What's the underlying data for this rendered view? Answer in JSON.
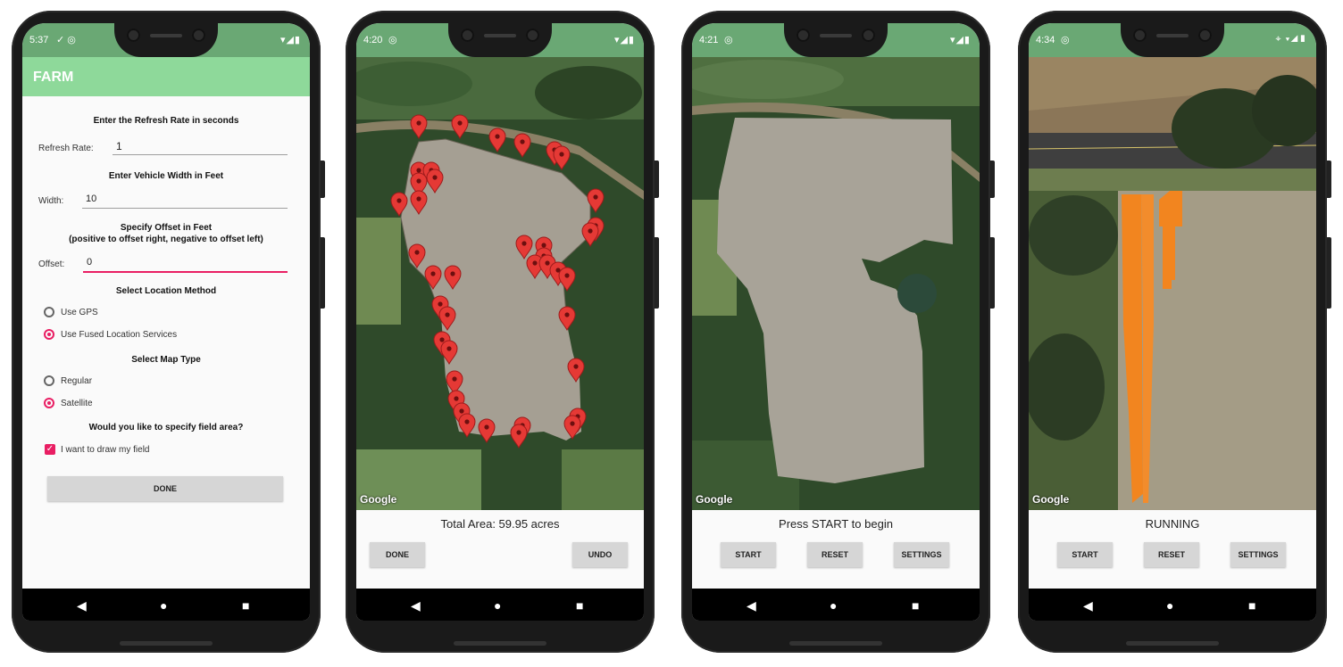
{
  "phones": [
    {
      "status": {
        "time": "5:37",
        "icons": "▾◢▮"
      },
      "app_title": "FARM",
      "form": {
        "refresh_header": "Enter the Refresh Rate in seconds",
        "refresh_label": "Refresh Rate:",
        "refresh_value": "1",
        "width_header": "Enter Vehicle Width in Feet",
        "width_label": "Width:",
        "width_value": "10",
        "offset_header_line1": "Specify Offset in Feet",
        "offset_header_line2": "(positive to offset right, negative to offset left)",
        "offset_label": "Offset:",
        "offset_value": "0",
        "location_header": "Select Location Method",
        "use_gps": "Use GPS",
        "use_fused": "Use Fused Location Services",
        "location_selected": "Use Fused Location Services",
        "maptype_header": "Select Map Type",
        "regular": "Regular",
        "satellite": "Satellite",
        "maptype_selected": "Satellite",
        "field_header": "Would you like to specify field area?",
        "draw_field": "I want to draw my field",
        "draw_field_checked": true,
        "done_button": "DONE"
      }
    },
    {
      "status": {
        "time": "4:20",
        "icons": "▾◢▮"
      },
      "map_attribution": "Google",
      "panel_text": "Total Area: 59.95 acres",
      "buttons": [
        "DONE",
        "UNDO"
      ]
    },
    {
      "status": {
        "time": "4:21",
        "icons": "▾◢▮"
      },
      "map_attribution": "Google",
      "panel_text": "Press START to begin",
      "buttons": [
        "START",
        "RESET",
        "SETTINGS"
      ]
    },
    {
      "status": {
        "time": "4:34",
        "icons": "⌖ ▾◢▮"
      },
      "map_attribution": "Google",
      "panel_text": "RUNNING",
      "buttons": [
        "START",
        "RESET",
        "SETTINGS"
      ]
    }
  ],
  "colors": {
    "status_bar": "#6aa874",
    "app_bar": "#8ed99a",
    "accent": "#e91e63",
    "marker": "#e53935",
    "coverage": "#f2851f"
  },
  "nav_icons": [
    "back-icon",
    "home-icon",
    "recents-icon"
  ]
}
